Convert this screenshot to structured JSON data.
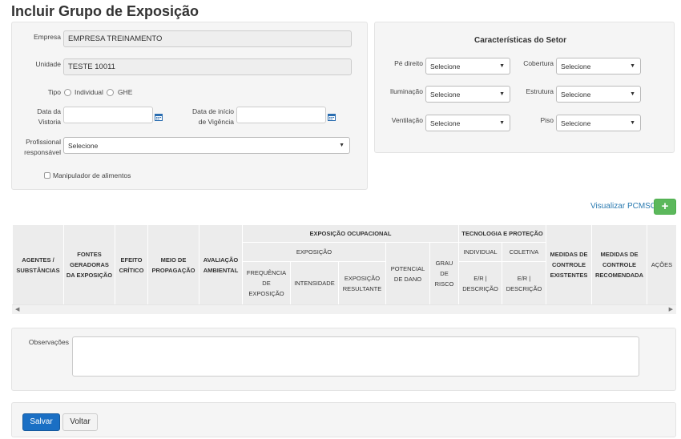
{
  "page": {
    "title": "Incluir Grupo de Exposição"
  },
  "form": {
    "empresa_label": "Empresa",
    "empresa_value": "EMPRESA TREINAMENTO",
    "unidade_label": "Unidade",
    "unidade_value": "TESTE 10011",
    "tipo_label": "Tipo",
    "tipo_options": [
      "Individual",
      "GHE"
    ],
    "data_vistoria_label_1": "Data da",
    "data_vistoria_label_2": "Vistoria",
    "data_inicio_label_1": "Data de início",
    "data_inicio_label_2": "de Vigência",
    "profissional_label_1": "Profissional",
    "profissional_label_2": "responsável",
    "profissional_value": "Selecione",
    "manipulador_label": "Manipulador de alimentos",
    "calendar_icon": "calendar-icon"
  },
  "setor": {
    "title": "Características do Setor",
    "fields": [
      {
        "label": "Pé direito",
        "value": "Selecione"
      },
      {
        "label": "Cobertura",
        "value": "Selecione"
      },
      {
        "label": "Iluminação",
        "value": "Selecione"
      },
      {
        "label": "Estrutura",
        "value": "Selecione"
      },
      {
        "label": "Ventilação",
        "value": "Selecione"
      },
      {
        "label": "Piso",
        "value": "Selecione"
      }
    ]
  },
  "pcmso": {
    "link_label": "Visualizar PCMSO",
    "add_label": "+"
  },
  "table": {
    "agentes": "AGENTES / SUBSTÂNCIAS",
    "fontes": "FONTES GERADORAS DA EXPOSIÇÃO",
    "efeito": "EFEITO CRÍTICO",
    "meio": "MEIO DE PROPAGAÇÃO",
    "avaliacao": "AVALIAÇÃO AMBIENTAL",
    "exp_ocup": "EXPOSIÇÃO OCUPACIONAL",
    "exposicao": "EXPOSIÇÃO",
    "frequencia": "FREQUÊNCIA DE EXPOSIÇÃO",
    "intensidade": "INTENSIDADE",
    "exp_resultante": "EXPOSIÇÃO RESULTANTE",
    "potencial": "POTENCIAL DE DANO",
    "grau": "GRAU DE RISCO",
    "tecnologia": "TECNOLOGIA E PROTEÇÃO",
    "individual": "INDIVIDUAL",
    "coletiva": "COLETIVA",
    "er_desc": "E/R | DESCRIÇÃO",
    "med_exist": "MEDIDAS DE CONTROLE EXISTENTES",
    "med_recom": "MEDIDAS DE CONTROLE RECOMENDADA",
    "acoes": "AÇÕES"
  },
  "observacoes": {
    "label": "Observações",
    "value": ""
  },
  "actions": {
    "salvar": "Salvar",
    "voltar": "Voltar"
  }
}
